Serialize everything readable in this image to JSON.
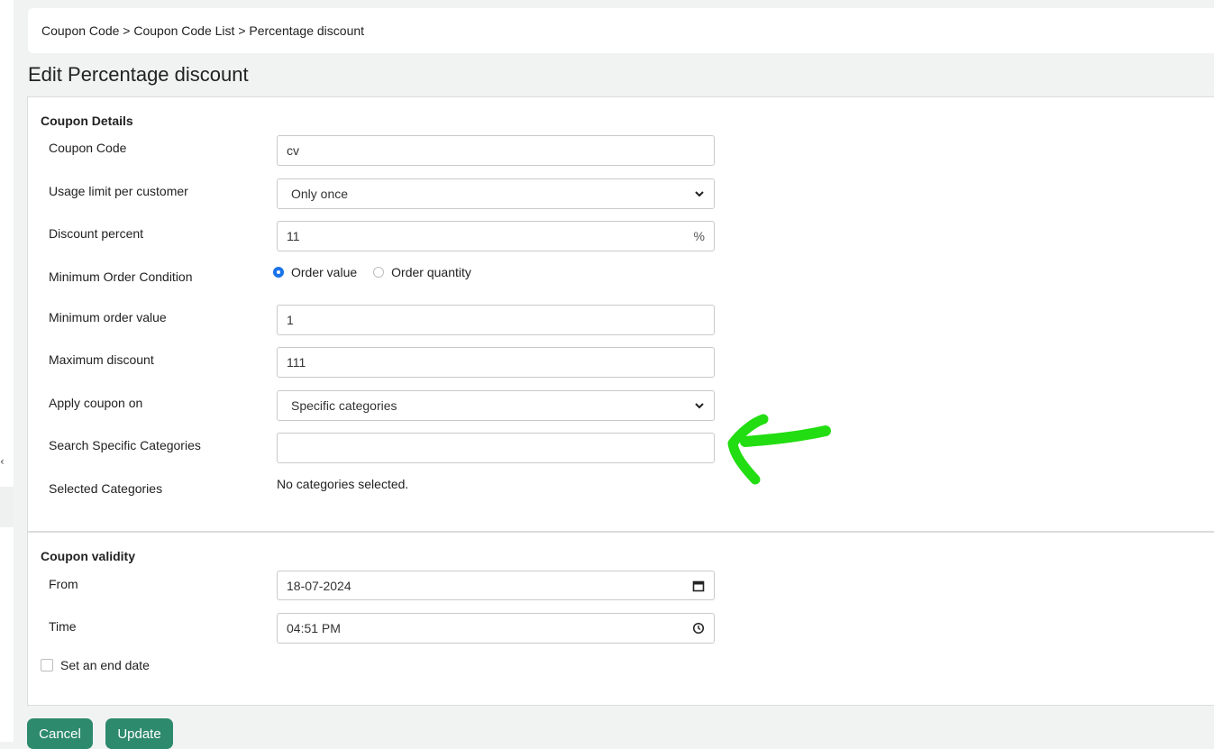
{
  "breadcrumb": {
    "text": "Coupon Code > Coupon Code List > Percentage discount"
  },
  "page": {
    "title": "Edit Percentage discount"
  },
  "details": {
    "section_title": "Coupon Details",
    "coupon_code": {
      "label": "Coupon Code",
      "value": "cv"
    },
    "usage_limit": {
      "label": "Usage limit per customer",
      "value": "Only once"
    },
    "discount_percent": {
      "label": "Discount percent",
      "value": "11",
      "suffix": "%"
    },
    "min_order_condition": {
      "label": "Minimum Order Condition",
      "options": [
        "Order value",
        "Order quantity"
      ],
      "selected": "Order value"
    },
    "min_order_value": {
      "label": "Minimum order value",
      "value": "1"
    },
    "max_discount": {
      "label": "Maximum discount",
      "value": "111"
    },
    "apply_on": {
      "label": "Apply coupon on",
      "value": "Specific categories"
    },
    "search_categories": {
      "label": "Search Specific Categories",
      "value": ""
    },
    "selected_categories": {
      "label": "Selected Categories",
      "value": "No categories selected."
    }
  },
  "validity": {
    "section_title": "Coupon validity",
    "from": {
      "label": "From",
      "value": "18-07-2024"
    },
    "time": {
      "label": "Time",
      "value": "04:51 PM"
    },
    "end_date": {
      "label": "Set an end date",
      "checked": false
    }
  },
  "actions": {
    "cancel": "Cancel",
    "update": "Update"
  },
  "colors": {
    "button": "#2e8a6d",
    "radio_active": "#1a73e8",
    "annotation_arrow": "#22dd11"
  },
  "icons": {
    "select": "chevron-down-icon",
    "date": "calendar-icon",
    "time": "clock-icon",
    "annotation": "hand-drawn-arrow-icon"
  }
}
